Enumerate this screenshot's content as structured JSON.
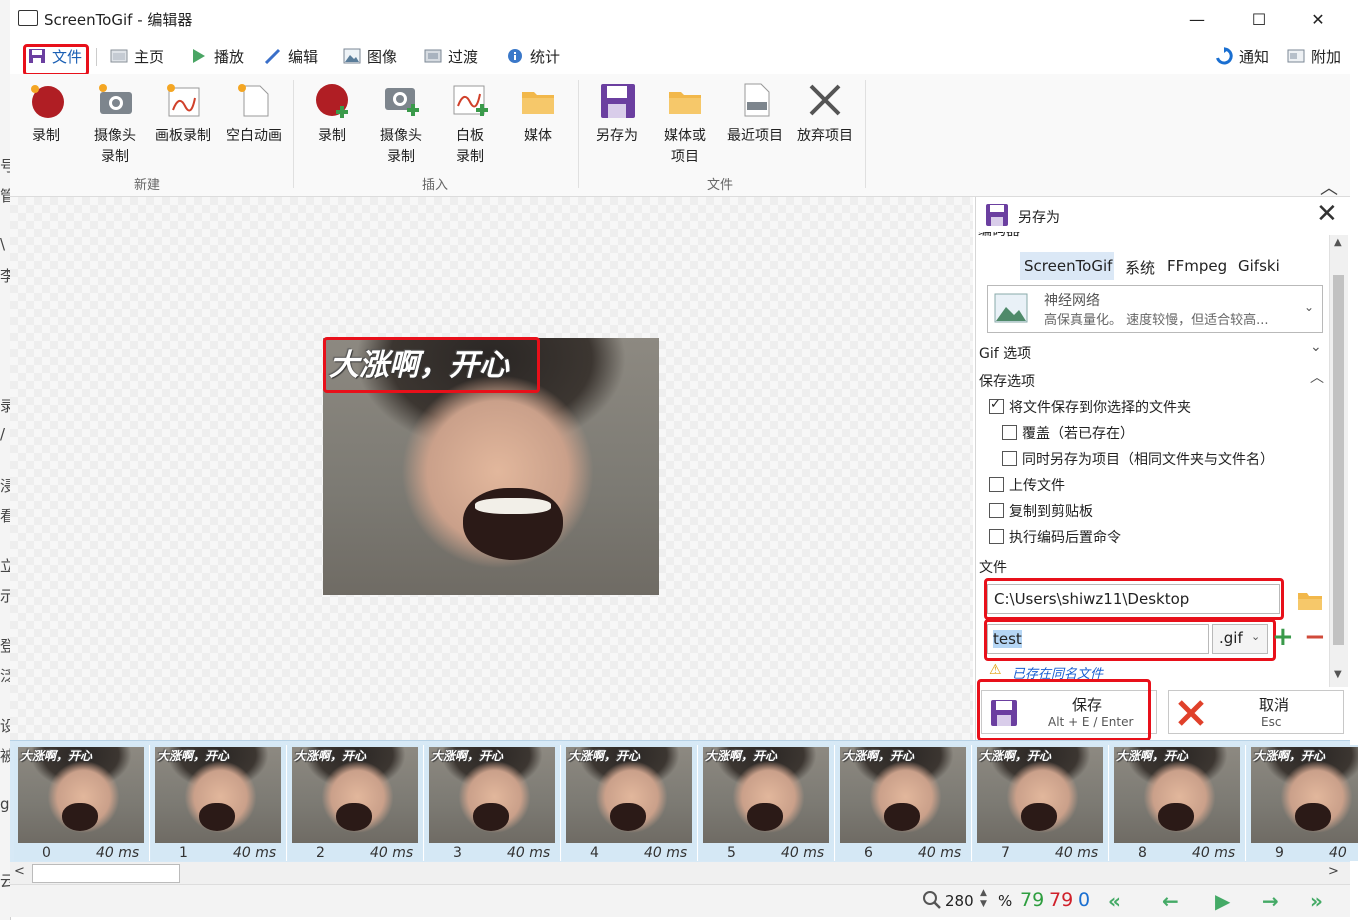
{
  "window": {
    "title": "ScreenToGif - 编辑器",
    "minimize": "—",
    "maximize": "☐",
    "close": "✕"
  },
  "left_bleed": [
    "号",
    "管",
    "\\",
    "李",
    "录",
    "/",
    "浸",
    "看",
    "立",
    "示",
    "登",
    "泛",
    "设",
    "被",
    "gl",
    "云"
  ],
  "tabs": [
    {
      "label": "文件",
      "icon": "save-icon"
    },
    {
      "label": "主页",
      "icon": "home-icon"
    },
    {
      "label": "播放",
      "icon": "play-icon"
    },
    {
      "label": "编辑",
      "icon": "pencil-icon"
    },
    {
      "label": "图像",
      "icon": "image-icon"
    },
    {
      "label": "过渡",
      "icon": "transition-icon"
    },
    {
      "label": "统计",
      "icon": "info-icon"
    }
  ],
  "tabs_right": [
    {
      "label": "通知",
      "icon": "sync-icon"
    },
    {
      "label": "附加",
      "icon": "extras-icon"
    }
  ],
  "ribbon": {
    "groups": [
      {
        "label": "新建",
        "buttons": [
          "录制",
          "摄像头\n录制",
          "画板录制",
          "空白动画"
        ]
      },
      {
        "label": "插入",
        "buttons": [
          "录制",
          "摄像头\n录制",
          "白板\n录制",
          "媒体"
        ]
      },
      {
        "label": "文件",
        "buttons": [
          "另存为",
          "媒体或\n项目",
          "最近项目",
          "放弃项目"
        ]
      }
    ]
  },
  "canvas": {
    "caption": "大涨啊，开心",
    "zoom": "280",
    "zoom_unit": "%"
  },
  "panel": {
    "title": "另存为",
    "cut_label": "编码器",
    "encoders": [
      "ScreenToGif",
      "系统",
      "FFmpeg",
      "Gifski"
    ],
    "selected_encoder": "ScreenToGif",
    "preset_name": "神经网络",
    "preset_desc": "高保真量化。 速度较慢，但适合较高...",
    "section_gif": "Gif 选项",
    "section_save": "保存选项",
    "options": [
      {
        "label": "将文件保存到你选择的文件夹",
        "checked": true
      },
      {
        "label": "覆盖（若已存在）",
        "checked": false
      },
      {
        "label": "同时另存为项目（相同文件夹与文件名）",
        "checked": false
      },
      {
        "label": "上传文件",
        "checked": false
      },
      {
        "label": "复制到剪贴板",
        "checked": false
      },
      {
        "label": "执行编码后置命令",
        "checked": false
      }
    ],
    "file_label": "文件",
    "folder_path": "C:\\Users\\shiwz11\\Desktop",
    "file_name": "test",
    "extension": ".gif",
    "warning": "已存在同名文件",
    "save_label": "保存",
    "save_shortcut": "Alt + E / Enter",
    "cancel_label": "取消",
    "cancel_shortcut": "Esc"
  },
  "frames": [
    {
      "num": "0",
      "delay": "40 ms"
    },
    {
      "num": "1",
      "delay": "40 ms"
    },
    {
      "num": "2",
      "delay": "40 ms"
    },
    {
      "num": "3",
      "delay": "40 ms"
    },
    {
      "num": "4",
      "delay": "40 ms"
    },
    {
      "num": "5",
      "delay": "40 ms"
    },
    {
      "num": "6",
      "delay": "40 ms"
    },
    {
      "num": "7",
      "delay": "40 ms"
    },
    {
      "num": "8",
      "delay": "40 ms"
    },
    {
      "num": "9",
      "delay": "40"
    }
  ],
  "thumb_caption": "大涨啊，开心",
  "status": {
    "total": "79",
    "selected": "79",
    "current": "0"
  },
  "colors": {
    "accent_red": "#e8101a",
    "save_purple": "#6b3fa0",
    "green": "#2e9e3f",
    "red_count": "#d0202a",
    "blue_count": "#1a6fd1"
  }
}
